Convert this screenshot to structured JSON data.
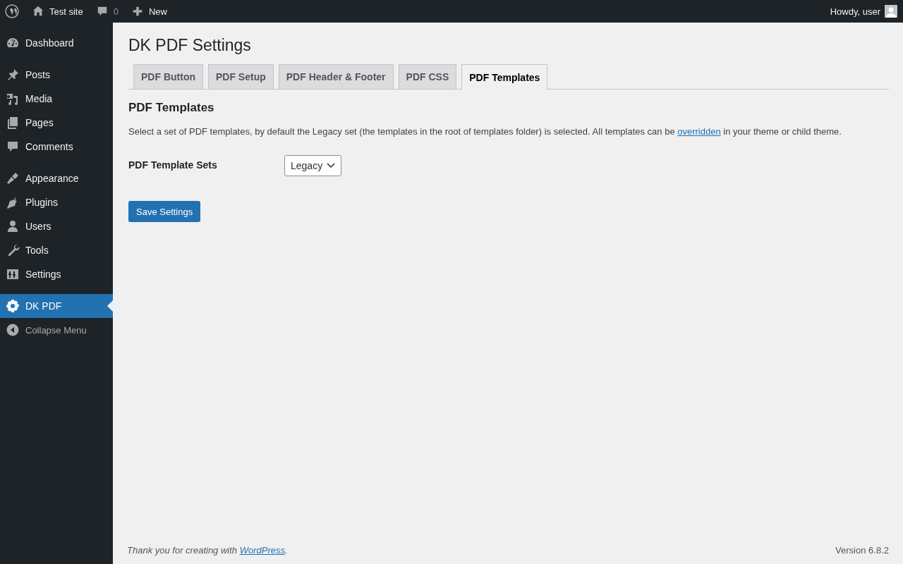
{
  "admin_bar": {
    "site": "Test site",
    "comments_count": "0",
    "new": "New",
    "greeting": "Howdy, user"
  },
  "sidebar": {
    "groups": [
      [
        {
          "label": "Dashboard",
          "selected": false
        }
      ],
      [
        {
          "label": "Posts",
          "selected": false
        },
        {
          "label": "Media",
          "selected": false
        },
        {
          "label": "Pages",
          "selected": false
        },
        {
          "label": "Comments",
          "selected": false
        }
      ],
      [
        {
          "label": "Appearance",
          "selected": false
        },
        {
          "label": "Plugins",
          "selected": false
        },
        {
          "label": "Users",
          "selected": false
        },
        {
          "label": "Tools",
          "selected": false
        },
        {
          "label": "Settings",
          "selected": false
        }
      ],
      [
        {
          "label": "DK PDF",
          "selected": true
        }
      ]
    ],
    "collapse": "Collapse Menu"
  },
  "page": {
    "title": "DK PDF Settings",
    "tabs": [
      {
        "label": "PDF Button",
        "selected": false
      },
      {
        "label": "PDF Setup",
        "selected": false
      },
      {
        "label": "PDF Header & Footer",
        "selected": false
      },
      {
        "label": "PDF CSS",
        "selected": false
      },
      {
        "label": "PDF Templates",
        "selected": true
      }
    ],
    "section_title": "PDF Templates",
    "description": {
      "before": "Select a set of PDF templates, by default the Legacy set (the templates in the root of templates folder) is selected. All templates can be ",
      "link": "overridden",
      "after": " in your theme or child theme."
    },
    "field": {
      "label": "PDF Template Sets",
      "value": "Legacy"
    },
    "save_button": "Save Settings"
  },
  "footer": {
    "before": "Thank you for creating with ",
    "link": "WordPress",
    "after": ".",
    "version": "Version 6.8.2"
  }
}
